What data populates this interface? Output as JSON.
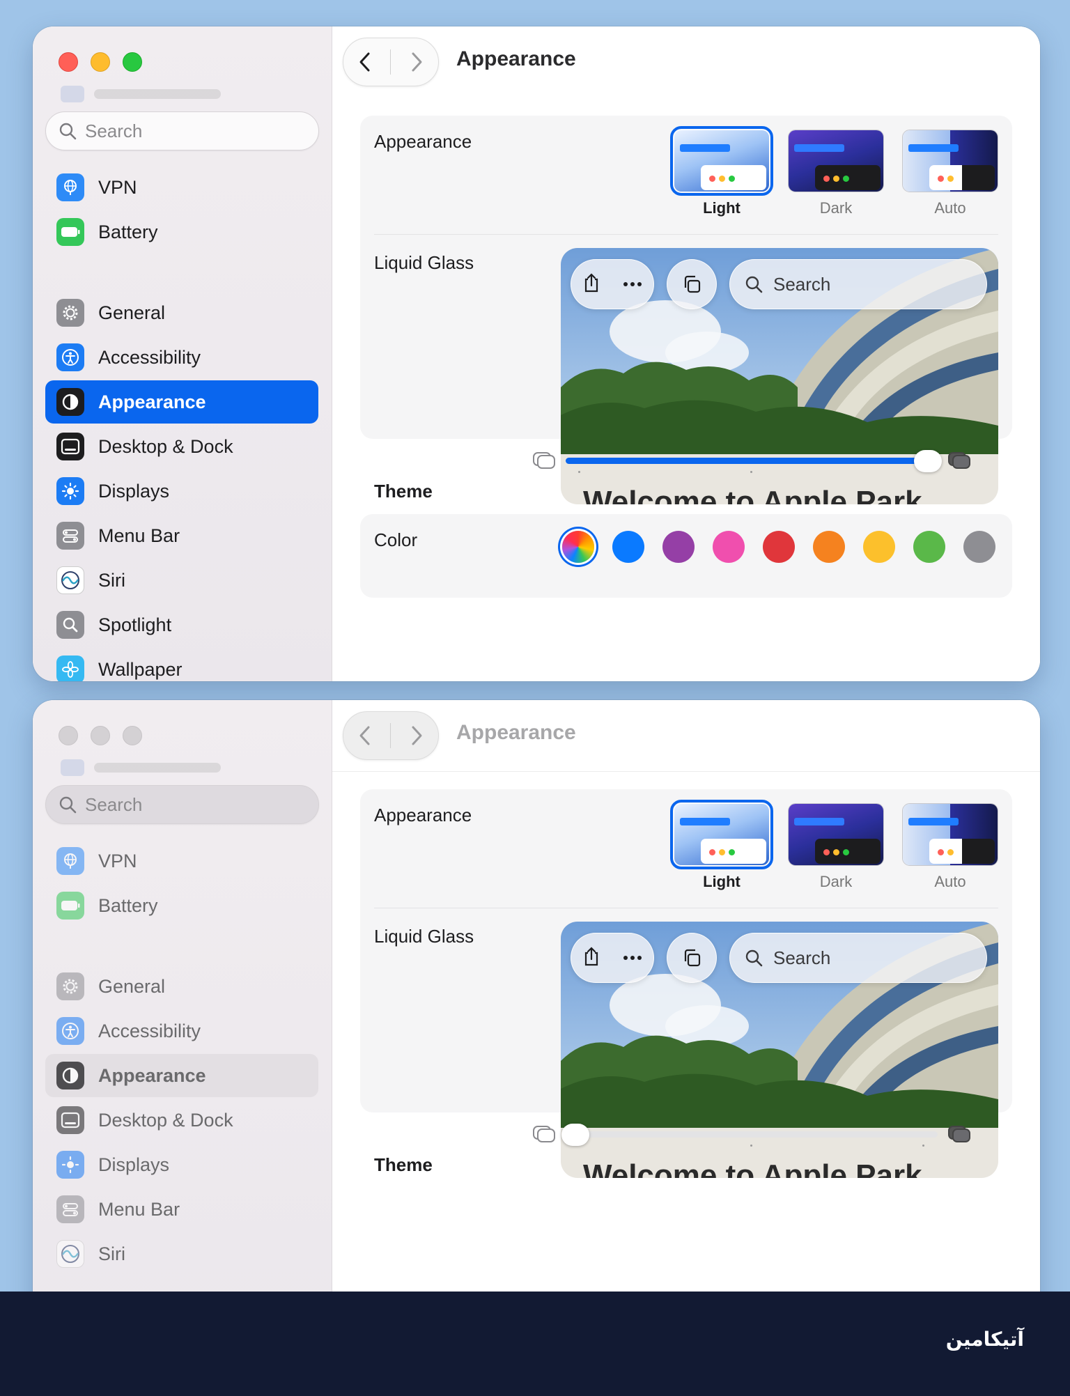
{
  "sidebar": {
    "search_placeholder": "Search",
    "items": [
      {
        "label": "VPN",
        "icon": "globe-icon"
      },
      {
        "label": "Battery",
        "icon": "battery-icon"
      },
      {
        "label": "General",
        "icon": "gear-icon"
      },
      {
        "label": "Accessibility",
        "icon": "accessibility-icon"
      },
      {
        "label": "Appearance",
        "icon": "appearance-icon"
      },
      {
        "label": "Desktop & Dock",
        "icon": "dock-icon"
      },
      {
        "label": "Displays",
        "icon": "sun-icon"
      },
      {
        "label": "Menu Bar",
        "icon": "menubar-icon"
      },
      {
        "label": "Siri",
        "icon": "siri-icon"
      },
      {
        "label": "Spotlight",
        "icon": "magnifier-icon"
      },
      {
        "label": "Wallpaper",
        "icon": "flower-icon"
      }
    ],
    "selected": "Appearance"
  },
  "toolbar": {
    "title": "Appearance"
  },
  "appearance": {
    "label": "Appearance",
    "options": [
      {
        "label": "Light",
        "selected": true
      },
      {
        "label": "Dark",
        "selected": false
      },
      {
        "label": "Auto",
        "selected": false
      }
    ]
  },
  "liquid_glass": {
    "label": "Liquid Glass",
    "preview_search": "Search",
    "preview_heading": "Welcome to Apple Park",
    "slider_top_value": 1.0,
    "slider_bottom_value": 0.0
  },
  "theme": {
    "heading": "Theme",
    "color_label": "Color",
    "swatches": [
      "multicolor",
      "#0a7aff",
      "#953fa6",
      "#f04fae",
      "#e0363b",
      "#f5821f",
      "#fcc02c",
      "#5ab849",
      "#8e8e93"
    ]
  },
  "footer": {
    "brand": "آتیکامین"
  },
  "colors": {
    "accent": "#0a66ee",
    "desktop": "#9fc4e8"
  }
}
